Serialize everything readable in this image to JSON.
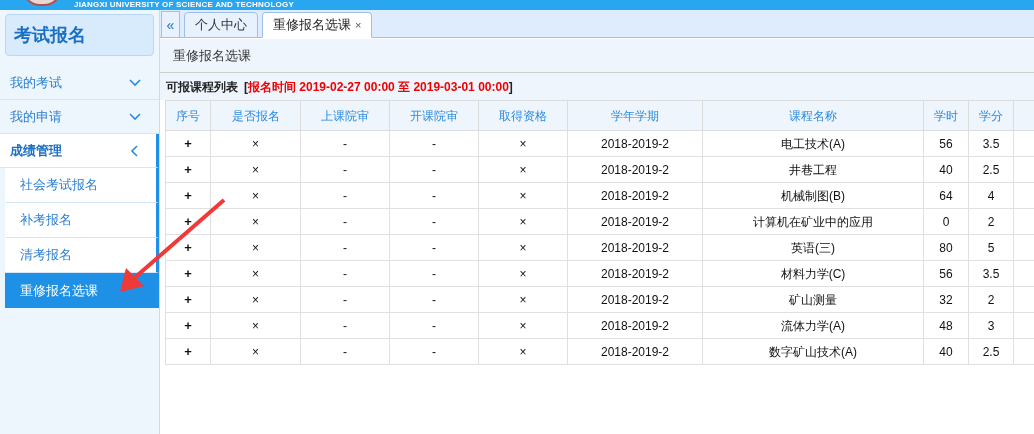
{
  "header": {
    "subtitle": "JIANGXI UNIVERSITY OF SCIENCE AND TECHNOLOGY"
  },
  "sidebar": {
    "title": "考试报名",
    "items": [
      {
        "label": "我的考试",
        "expanded": false
      },
      {
        "label": "我的申请",
        "expanded": false
      },
      {
        "label": "成绩管理",
        "expanded": true,
        "children": [
          {
            "label": "社会考试报名",
            "selected": false
          },
          {
            "label": "补考报名",
            "selected": false
          },
          {
            "label": "清考报名",
            "selected": false
          },
          {
            "label": "重修报名选课",
            "selected": true
          }
        ]
      }
    ]
  },
  "collapse_button": "«",
  "tabs": [
    {
      "label": "个人中心",
      "selected": false
    },
    {
      "label": "重修报名选课",
      "selected": true,
      "close": "×"
    }
  ],
  "page_title": "重修报名选课",
  "caption": {
    "title": "可报课程列表",
    "open_bracket": "[",
    "period": "报名时间 2019-02-27 00:00 至 2019-03-01 00:00",
    "close_bracket": "]"
  },
  "table": {
    "columns": [
      "序号",
      "是否报名",
      "上课院审",
      "开课院审",
      "取得资格",
      "学年学期",
      "课程名称",
      "学时",
      "学分"
    ],
    "rows": [
      [
        "+",
        "×",
        "-",
        "-",
        "×",
        "2018-2019-2",
        "电工技术(A)",
        "56",
        "3.5"
      ],
      [
        "+",
        "×",
        "-",
        "-",
        "×",
        "2018-2019-2",
        "井巷工程",
        "40",
        "2.5"
      ],
      [
        "+",
        "×",
        "-",
        "-",
        "×",
        "2018-2019-2",
        "机械制图(B)",
        "64",
        "4"
      ],
      [
        "+",
        "×",
        "-",
        "-",
        "×",
        "2018-2019-2",
        "计算机在矿业中的应用",
        "0",
        "2"
      ],
      [
        "+",
        "×",
        "-",
        "-",
        "×",
        "2018-2019-2",
        "英语(三)",
        "80",
        "5"
      ],
      [
        "+",
        "×",
        "-",
        "-",
        "×",
        "2018-2019-2",
        "材料力学(C)",
        "56",
        "3.5"
      ],
      [
        "+",
        "×",
        "-",
        "-",
        "×",
        "2018-2019-2",
        "矿山测量",
        "32",
        "2"
      ],
      [
        "+",
        "×",
        "-",
        "-",
        "×",
        "2018-2019-2",
        "流体力学(A)",
        "48",
        "3"
      ],
      [
        "+",
        "×",
        "-",
        "-",
        "×",
        "2018-2019-2",
        "数字矿山技术(A)",
        "40",
        "2.5"
      ]
    ]
  }
}
